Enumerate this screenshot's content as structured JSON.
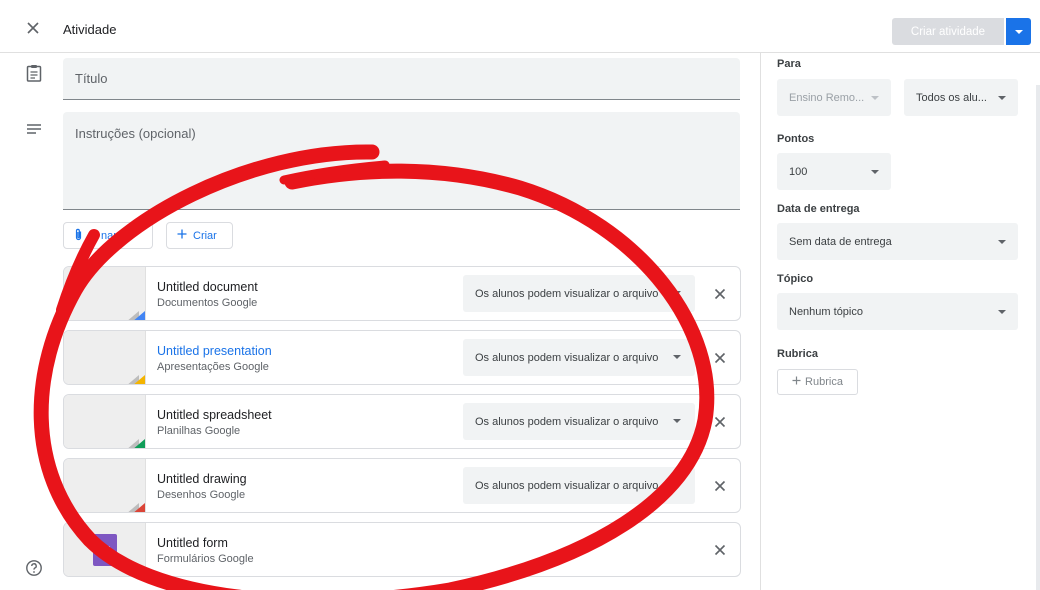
{
  "header": {
    "title": "Atividade",
    "create_button": "Criar atividade"
  },
  "form": {
    "title_placeholder": "Título",
    "instructions_placeholder": "Instruções (opcional)",
    "add_button": "Adicionar",
    "add_button_visible": "nar",
    "create_button": "Criar"
  },
  "attachments": [
    {
      "name": "Untitled document",
      "type": "Documentos Google",
      "permission": "Os alunos podem visualizar o arquivo",
      "accent": "#4285f4"
    },
    {
      "name": "Untitled presentation",
      "type": "Apresentações Google",
      "permission": "Os alunos podem visualizar o arquivo",
      "accent": "#f4b400"
    },
    {
      "name": "Untitled spreadsheet",
      "type": "Planilhas Google",
      "permission": "Os alunos podem visualizar o arquivo",
      "accent": "#0f9d58"
    },
    {
      "name": "Untitled drawing",
      "type": "Desenhos Google",
      "permission": "Os alunos podem visualizar o arquivo",
      "accent": "#db4437"
    },
    {
      "name": "Untitled form",
      "type": "Formulários Google",
      "accent": "#673ab7"
    }
  ],
  "settings": {
    "para_label": "Para",
    "class_value": "Ensino Remo...",
    "students_value": "Todos os alu...",
    "points_label": "Pontos",
    "points_value": "100",
    "due_label": "Data de entrega",
    "due_value": "Sem data de entrega",
    "topic_label": "Tópico",
    "topic_value": "Nenhum tópico",
    "rubric_label": "Rubrica",
    "rubric_button": "Rubrica"
  },
  "colors": {
    "accent_blue": "#1a73e8",
    "annotation_red": "#e8141a"
  },
  "icons": [
    "close-icon",
    "assignment-icon",
    "notes-icon",
    "paperclip-icon",
    "plus-icon",
    "help-icon",
    "dropdown-arrow-icon"
  ]
}
